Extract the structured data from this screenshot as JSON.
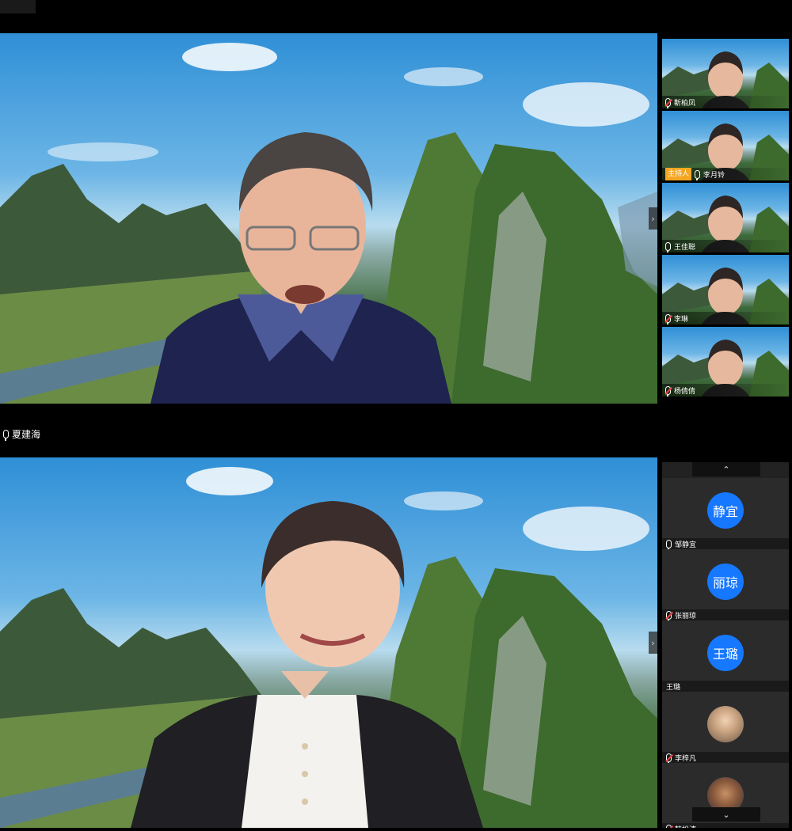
{
  "main_top": {
    "speaker_name": "夏建海"
  },
  "thumbnails": [
    {
      "name": "靳柏凤",
      "host": false,
      "muted": true
    },
    {
      "name": "李月铃",
      "host": true,
      "host_label": "主持人",
      "muted": false
    },
    {
      "name": "王佳聪",
      "host": false,
      "muted": false
    },
    {
      "name": "李琳",
      "host": false,
      "muted": true
    },
    {
      "name": "杨倩倩",
      "host": false,
      "muted": true
    }
  ],
  "participant_list": {
    "scroll_up": "⌃",
    "scroll_down": "⌄",
    "items": [
      {
        "avatar_text": "静宜",
        "name": "邹静宜",
        "muted": false,
        "avatar_type": "initials"
      },
      {
        "avatar_text": "丽琼",
        "name": "张丽琼",
        "muted": true,
        "avatar_type": "initials"
      },
      {
        "avatar_text": "王璐",
        "name": "王璐",
        "muted": false,
        "avatar_type": "initials",
        "no_mic": true
      },
      {
        "avatar_text": "",
        "name": "李梓凡",
        "muted": true,
        "avatar_type": "photo"
      },
      {
        "avatar_text": "",
        "name": "韩松涛",
        "muted": true,
        "avatar_type": "cartoon"
      }
    ]
  },
  "colors": {
    "avatar_blue": "#1677ff",
    "host_badge": "#f5a623",
    "panel_bg": "#222222"
  }
}
